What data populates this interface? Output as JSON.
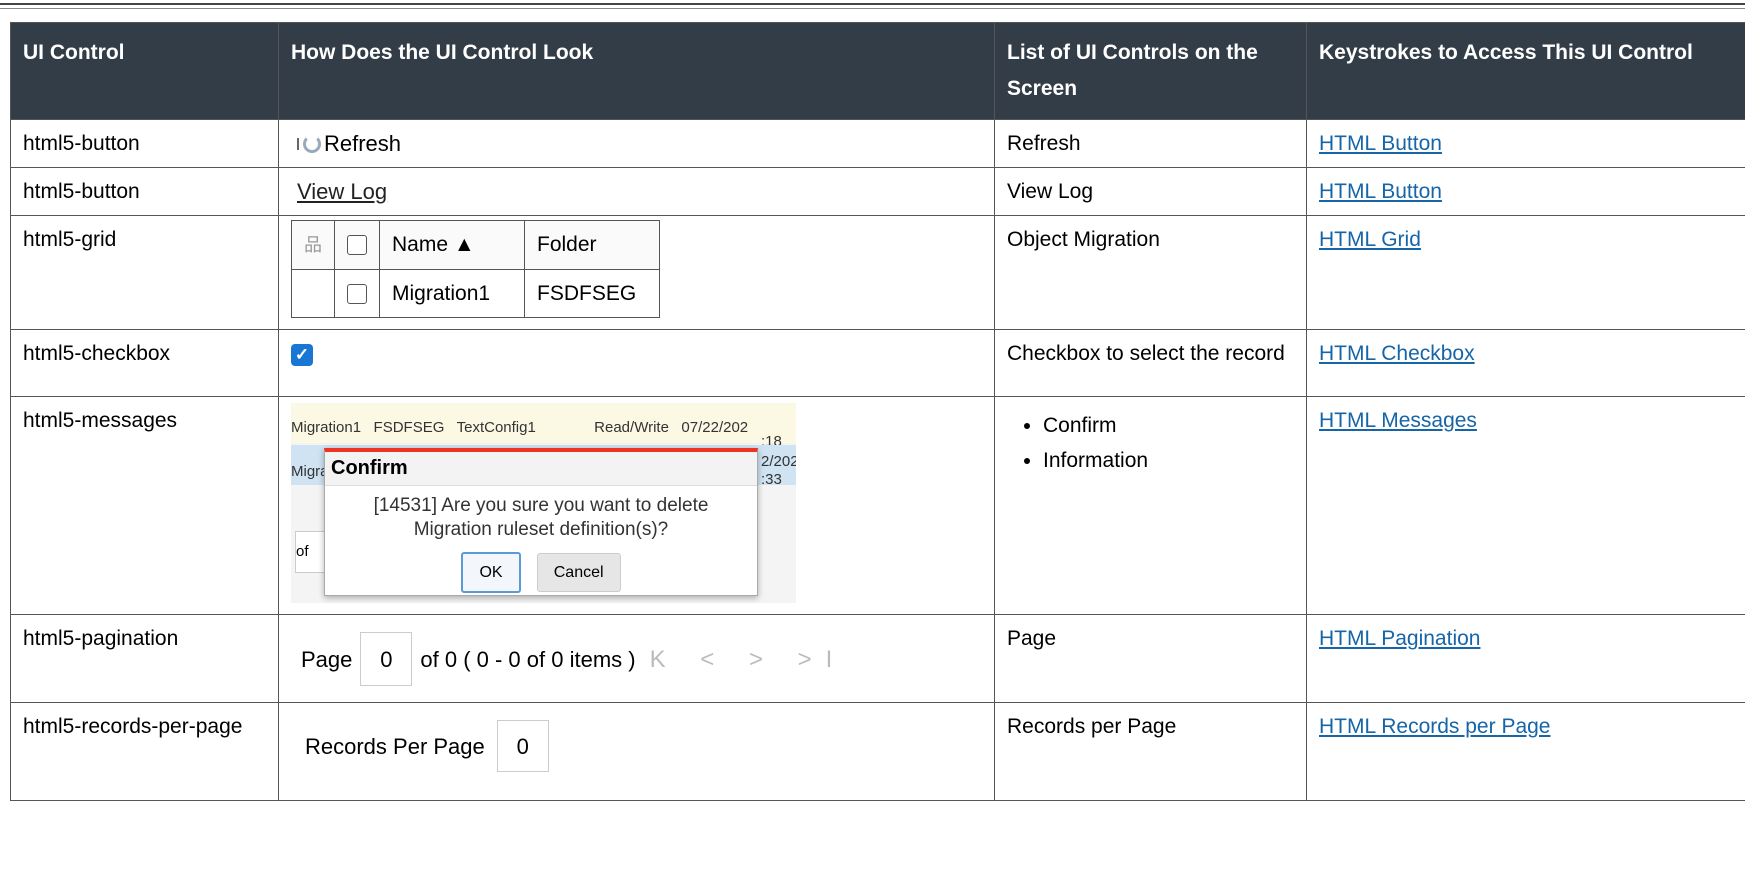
{
  "headers": [
    "UI Control",
    "How Does the UI Control Look",
    "List of UI Controls on the Screen",
    "Keystrokes to Access This UI Control"
  ],
  "rows": [
    {
      "control": "html5-button",
      "list": "Refresh",
      "link": "HTML Button"
    },
    {
      "control": "html5-button",
      "list": "View Log",
      "link": "HTML Button"
    },
    {
      "control": "html5-grid",
      "list": "Object Migration",
      "link": "HTML Grid"
    },
    {
      "control": "html5-checkbox",
      "list": "Checkbox to select the record",
      "link": "HTML Checkbox"
    },
    {
      "control": "html5-messages",
      "list_items": [
        "Confirm",
        "Information"
      ],
      "link": "HTML Messages"
    },
    {
      "control": "html5-pagination",
      "list": "Page",
      "link": "HTML Pagination"
    },
    {
      "control": "html5-records-per-page",
      "list": "Records per Page",
      "link": "HTML Records per Page"
    }
  ],
  "samples": {
    "refresh_label": "Refresh",
    "viewlog_label": "View Log",
    "grid": {
      "col_name": "Name ▲",
      "col_folder": "Folder",
      "row_name": "Migration1",
      "row_folder": "FSDFSEG"
    },
    "messages": {
      "bg_row1": "Migration1   FSDFSEG   TextConfig1              Read/Write   07/22/202",
      "bg_row1b": ":18",
      "bg_row2": "Migra",
      "bg_row2b": "2/202",
      "bg_row2c": ":33",
      "bg_of": "of",
      "dialog_title": "Confirm",
      "dialog_text_1": "[14531] Are you sure you want to delete",
      "dialog_text_2": "Migration ruleset definition(s)?",
      "ok": "OK",
      "cancel": "Cancel"
    },
    "pagination": {
      "page_label": "Page",
      "page_value": "0",
      "summary": "of 0 ( 0 - 0 of 0 items )",
      "nav": "K < > >I"
    },
    "records": {
      "label": "Records Per Page",
      "value": "0"
    }
  }
}
